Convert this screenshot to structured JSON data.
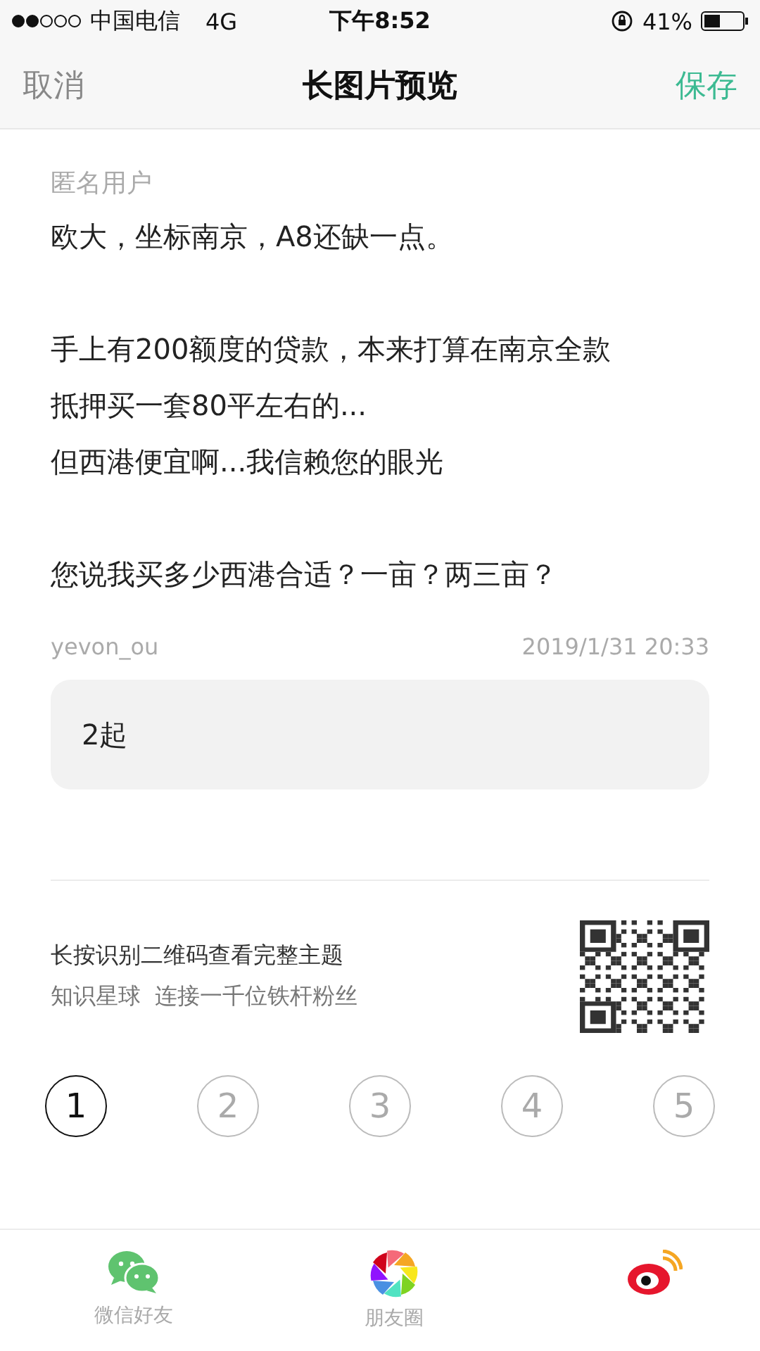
{
  "status_bar": {
    "carrier": "中国电信",
    "network": "4G",
    "time": "下午8:52",
    "battery": "41%"
  },
  "nav": {
    "cancel": "取消",
    "title": "长图片预览",
    "save": "保存"
  },
  "post": {
    "author": "匿名用户",
    "paragraphs": [
      [
        "欧大，坐标南京，A8还缺一点。"
      ],
      [
        "手上有200额度的贷款，本来打算在南京全款",
        "抵押买一套80平左右的...",
        "但西港便宜啊...我信赖您的眼光"
      ],
      [
        "您说我买多少西港合适？一亩？两三亩？"
      ]
    ]
  },
  "reply": {
    "user": "yevon_ou",
    "time": "2019/1/31 20:33",
    "text": "2起"
  },
  "footer": {
    "hint": "长按识别二维码查看完整主题",
    "slogan": "知识星球  连接一千位铁杆粉丝"
  },
  "pages": [
    {
      "label": "1",
      "selected": true
    },
    {
      "label": "2",
      "selected": false
    },
    {
      "label": "3",
      "selected": false
    },
    {
      "label": "4",
      "selected": false
    },
    {
      "label": "5",
      "selected": false
    }
  ],
  "share": [
    {
      "kind": "wechat",
      "label": "微信好友"
    },
    {
      "kind": "moments",
      "label": "朋友圈"
    },
    {
      "kind": "weibo"
    }
  ]
}
